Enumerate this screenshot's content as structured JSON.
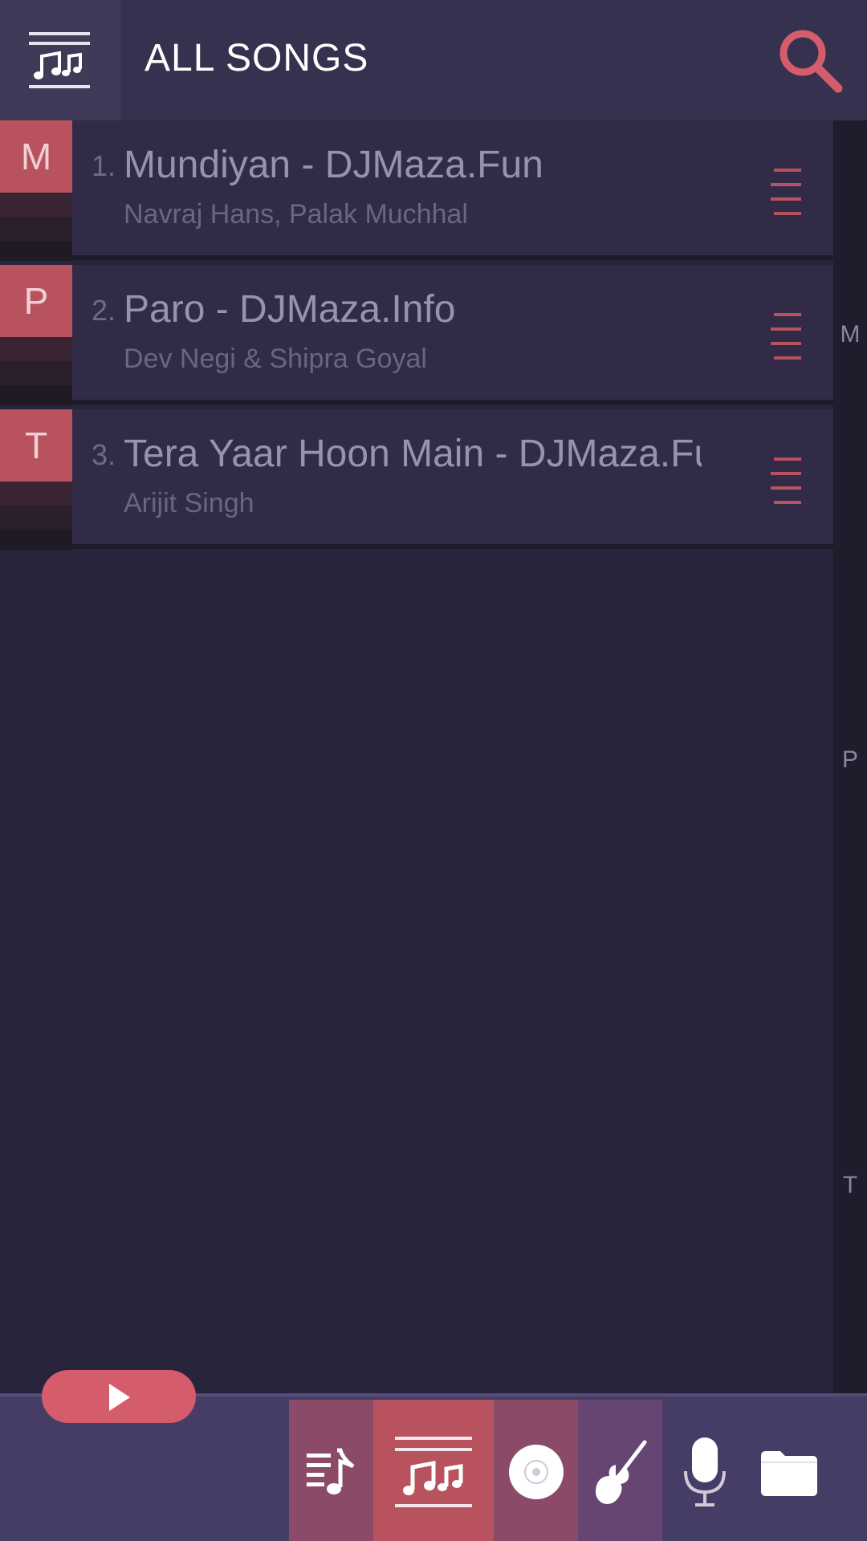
{
  "header": {
    "title": "ALL SONGS",
    "menu_icon": "playlist-menu-icon",
    "search_icon": "search-icon"
  },
  "songs": [
    {
      "letter": "M",
      "number": "1.",
      "title": "Mundiyan - DJMaza.Fun",
      "artist": "Navraj Hans, Palak Muchhal"
    },
    {
      "letter": "P",
      "number": "2.",
      "title": "Paro - DJMaza.Info",
      "artist": "Dev Negi & Shipra Goyal"
    },
    {
      "letter": "T",
      "number": "3.",
      "title": "Tera Yaar Hoon Main - DJMaza.Fun",
      "artist": "Arijit Singh"
    }
  ],
  "index": [
    "M",
    "P",
    "T"
  ],
  "bottom_tabs": [
    {
      "name": "playlists",
      "icon": "playlist-note-icon",
      "active": false
    },
    {
      "name": "songs",
      "icon": "music-notes-icon",
      "active": true
    },
    {
      "name": "albums",
      "icon": "disc-icon",
      "active": false
    },
    {
      "name": "artists",
      "icon": "guitar-icon",
      "active": false
    },
    {
      "name": "genres",
      "icon": "microphone-icon",
      "active": false
    },
    {
      "name": "folders",
      "icon": "folder-icon",
      "active": false
    }
  ],
  "colors": {
    "accent": "#d55c6a",
    "background": "#28243c",
    "header": "#373150",
    "bottom_bar": "#463d66"
  }
}
